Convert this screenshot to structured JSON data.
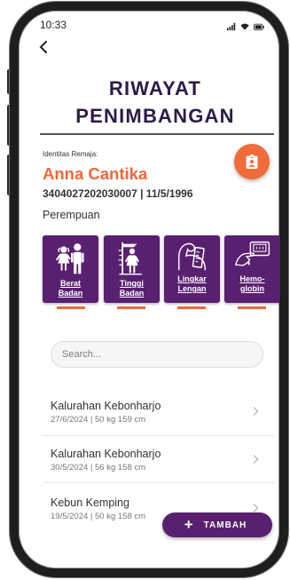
{
  "status_bar": {
    "time": "10:33",
    "icons": [
      "signal-icon",
      "wifi-icon",
      "battery-icon"
    ]
  },
  "header": {
    "back_icon": "chevron-left-icon",
    "title_line1": "RIWAYAT",
    "title_line2": "PENIMBANGAN"
  },
  "profile": {
    "label": "Identitas Remaja:",
    "name": "Anna Cantika",
    "id_line": "3404027202030007 | 11/5/1996",
    "gender": "Perempuan",
    "action_icon": "id-badge-icon"
  },
  "categories": [
    {
      "lines": [
        "Berat",
        "Badan"
      ],
      "icon": "weight-scale-icon"
    },
    {
      "lines": [
        "Tinggi",
        "Badan"
      ],
      "icon": "height-measure-icon"
    },
    {
      "lines": [
        "Lingkar",
        "Lengan"
      ],
      "icon": "arm-circumference-icon"
    },
    {
      "lines": [
        "Hemo-",
        "globin"
      ],
      "icon": "hemoglobin-meter-icon"
    }
  ],
  "search": {
    "placeholder": "Search..."
  },
  "records": [
    {
      "title": "Kalurahan Kebonharjo",
      "subtitle": "27/6/2024 | 50 kg 159 cm"
    },
    {
      "title": "Kalurahan Kebonharjo",
      "subtitle": "30/5/2024 | 56 kg 158 cm"
    },
    {
      "title": "Kebun Kemping",
      "subtitle": "19/5/2024 | 50 kg 158 cm"
    }
  ],
  "fab": {
    "icon_text": "+",
    "label": "TAMBAH"
  },
  "colors": {
    "primary": "#5a2070",
    "accent": "#f26b3a",
    "title": "#2d1b47"
  }
}
